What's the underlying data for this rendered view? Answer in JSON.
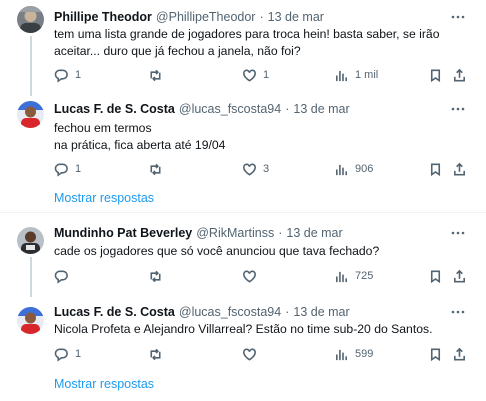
{
  "tweets": [
    {
      "name": "Phillipe Theodor",
      "handle": "@PhillipeTheodor",
      "date": "13 de mar",
      "lines": [
        "tem uma lista grande de jogadores para troca hein! basta saber, se irão",
        "aceitar... duro que já fechou a janela, não foi?"
      ],
      "reply_count": "1",
      "retweet_count": "",
      "like_count": "1",
      "view_count": "1 mil"
    },
    {
      "name": "Lucas F. de S. Costa",
      "handle": "@lucas_fscosta94",
      "date": "13 de mar",
      "lines": [
        "fechou em termos",
        "na prática, fica aberta até 19/04"
      ],
      "reply_count": "1",
      "retweet_count": "",
      "like_count": "3",
      "view_count": "906"
    },
    {
      "name": "Mundinho Pat Beverley",
      "handle": "@RikMartinss",
      "date": "13 de mar",
      "lines": [
        "cade os jogadores que só você anunciou que tava fechado?"
      ],
      "reply_count": "",
      "retweet_count": "",
      "like_count": "",
      "view_count": "725"
    },
    {
      "name": "Lucas F. de S. Costa",
      "handle": "@lucas_fscosta94",
      "date": "13 de mar",
      "lines": [
        "Nicola Profeta e Alejandro Villarreal? Estão no time sub-20 do Santos."
      ],
      "reply_count": "1",
      "retweet_count": "",
      "like_count": "",
      "view_count": "599"
    }
  ],
  "show_replies_label": "Mostrar respostas",
  "dot": "·",
  "colors": {
    "accent": "#1d9bf0",
    "muted": "#536471",
    "divider": "#eff3f4"
  }
}
